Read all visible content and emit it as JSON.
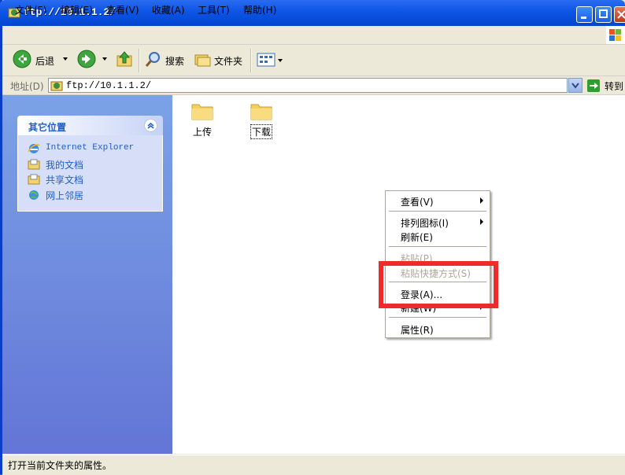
{
  "window": {
    "title": "ftp://10.1.1.2/"
  },
  "menubar": {
    "items": [
      "文件(F)",
      "编辑(E)",
      "查看(V)",
      "收藏(A)",
      "工具(T)",
      "帮助(H)"
    ]
  },
  "toolbar": {
    "back_label": "后退",
    "search_label": "搜索",
    "folders_label": "文件夹"
  },
  "address": {
    "label": "地址(D)",
    "value": "ftp://10.1.1.2/",
    "go_label": "转到"
  },
  "task_pane": {
    "title": "其它位置",
    "links": [
      "Internet Explorer",
      "我的文档",
      "共享文档",
      "网上邻居"
    ]
  },
  "folders": [
    {
      "name": "上传"
    },
    {
      "name": "下载"
    }
  ],
  "context_menu": {
    "items": [
      {
        "label": "查看(V)",
        "disabled": false,
        "submenu": true
      },
      {
        "label": "排列图标(I)",
        "disabled": false,
        "submenu": true
      },
      {
        "label": "刷新(E)",
        "disabled": false,
        "submenu": false
      },
      {
        "label": "粘贴(P)",
        "disabled": true,
        "submenu": false
      },
      {
        "label": "粘贴快捷方式(S)",
        "disabled": true,
        "submenu": false
      },
      {
        "label": "登录(A)...",
        "disabled": false,
        "submenu": false
      },
      {
        "label": "新建(W)",
        "disabled": false,
        "submenu": true
      },
      {
        "label": "属性(R)",
        "disabled": false,
        "submenu": false
      }
    ]
  },
  "highlight": {
    "color": "#ee2a2a"
  },
  "statusbar": {
    "text": "打开当前文件夹的属性。"
  }
}
